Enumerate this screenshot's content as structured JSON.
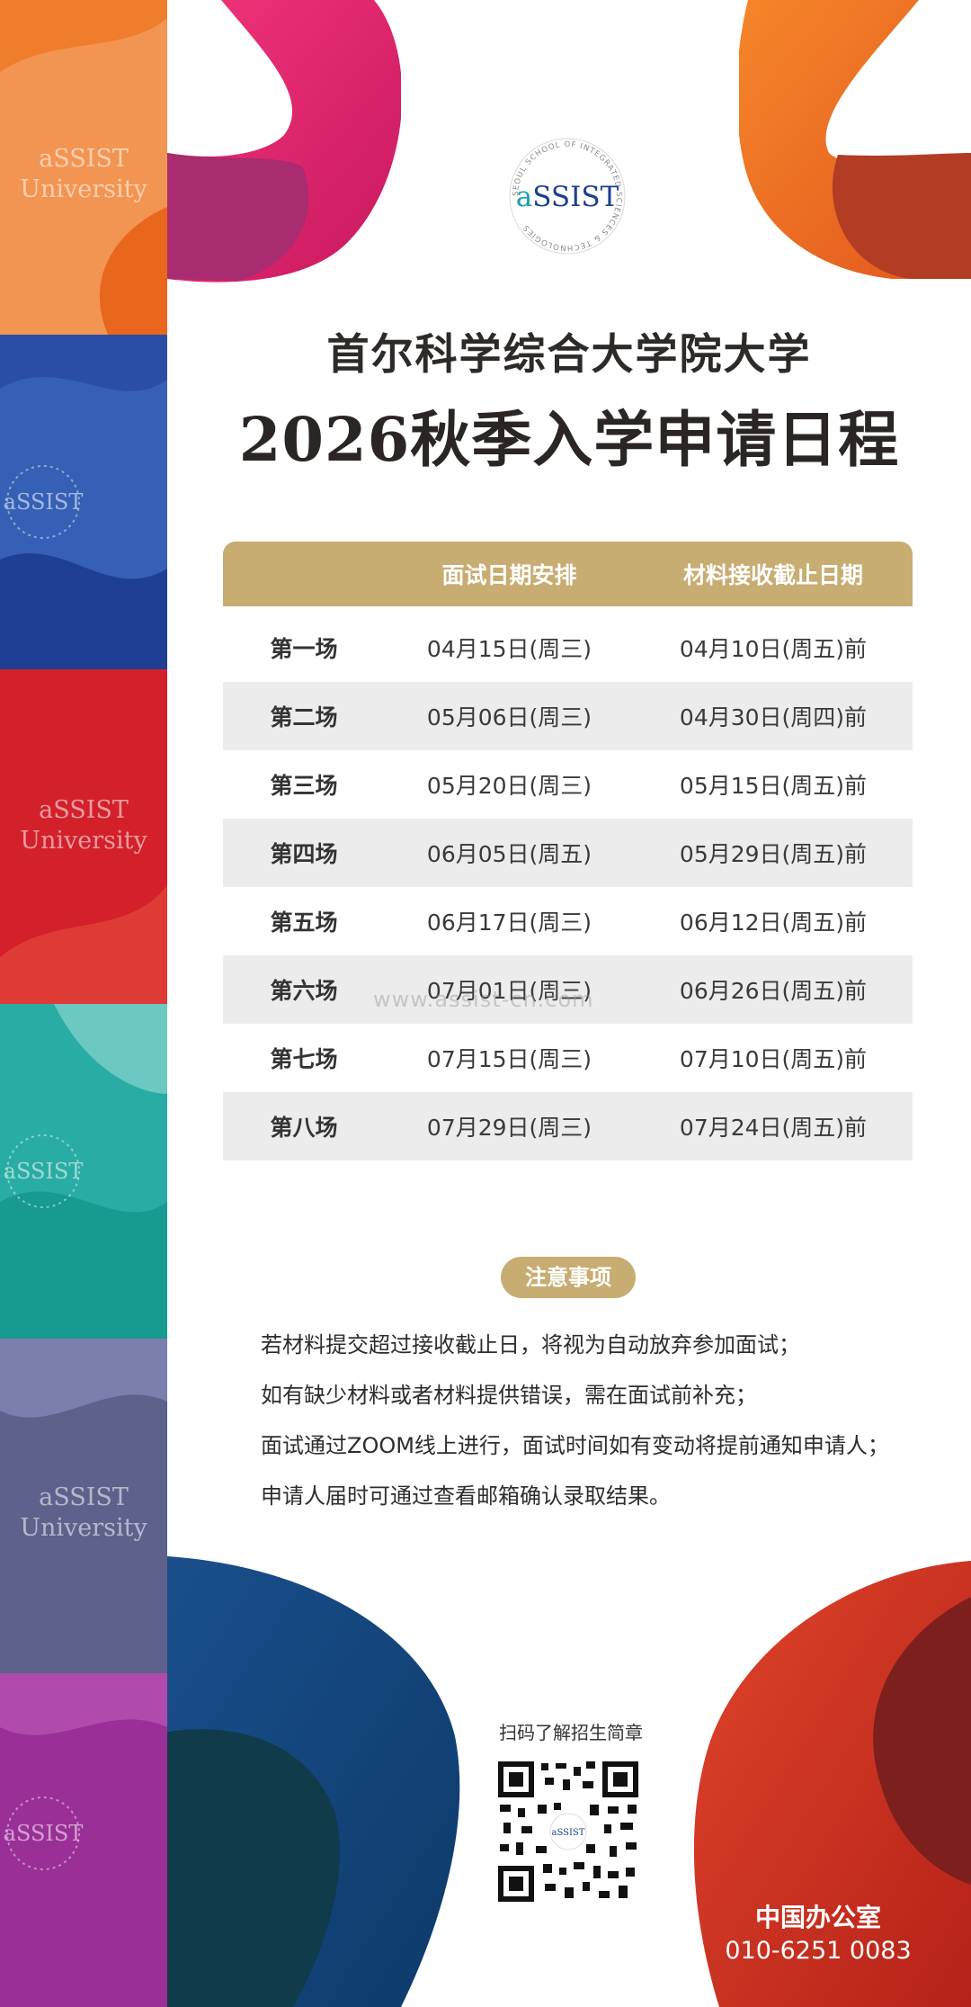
{
  "strip": {
    "brand_line1": "aSSIST",
    "brand_line2": "University",
    "colors": [
      "#f08a3c",
      "#2e52a8",
      "#d7262b",
      "#2db4aa",
      "#6c6f9a",
      "#9b2f97"
    ]
  },
  "logo": {
    "ring_text": "SEOUL SCHOOL OF INTEGRATED SCIENCES & TECHNOLOGIES",
    "brand_a": "a",
    "brand_rest": "SSIST"
  },
  "header": {
    "subtitle": "首尔科学综合大学院大学",
    "title": "2026秋季入学申请日程"
  },
  "schedule": {
    "columns": [
      "",
      "面试日期安排",
      "材料接收截止日期"
    ],
    "rows": [
      {
        "session": "第一场",
        "interview": "04月15日(周三)",
        "deadline": "04月10日(周五)前"
      },
      {
        "session": "第二场",
        "interview": "05月06日(周三)",
        "deadline": "04月30日(周四)前"
      },
      {
        "session": "第三场",
        "interview": "05月20日(周三)",
        "deadline": "05月15日(周五)前"
      },
      {
        "session": "第四场",
        "interview": "06月05日(周五)",
        "deadline": "05月29日(周五)前"
      },
      {
        "session": "第五场",
        "interview": "06月17日(周三)",
        "deadline": "06月12日(周五)前"
      },
      {
        "session": "第六场",
        "interview": "07月01日(周三)",
        "deadline": "06月26日(周五)前"
      },
      {
        "session": "第七场",
        "interview": "07月15日(周三)",
        "deadline": "07月10日(周五)前"
      },
      {
        "session": "第八场",
        "interview": "07月29日(周三)",
        "deadline": "07月24日(周五)前"
      }
    ]
  },
  "watermark": "www.assist-cn.com",
  "notes": {
    "badge": "注意事项",
    "lines": [
      "若材料提交超过接收截止日，将视为自动放弃参加面试；",
      "如有缺少材料或者材料提供错误，需在面试前补充；",
      "面试通过ZOOM线上进行，面试时间如有变动将提前通知申请人；",
      "申请人届时可通过查看邮箱确认录取结果。"
    ]
  },
  "qr": {
    "caption": "扫码了解招生简章",
    "center_label": "aSSIST"
  },
  "office": {
    "label": "中国办公室",
    "phone": "010-6251 0083"
  },
  "colors": {
    "gold": "#c8ad72",
    "row_shade": "#ececec",
    "brand_teal": "#1aa0b4",
    "brand_navy": "#1c3f8f"
  }
}
